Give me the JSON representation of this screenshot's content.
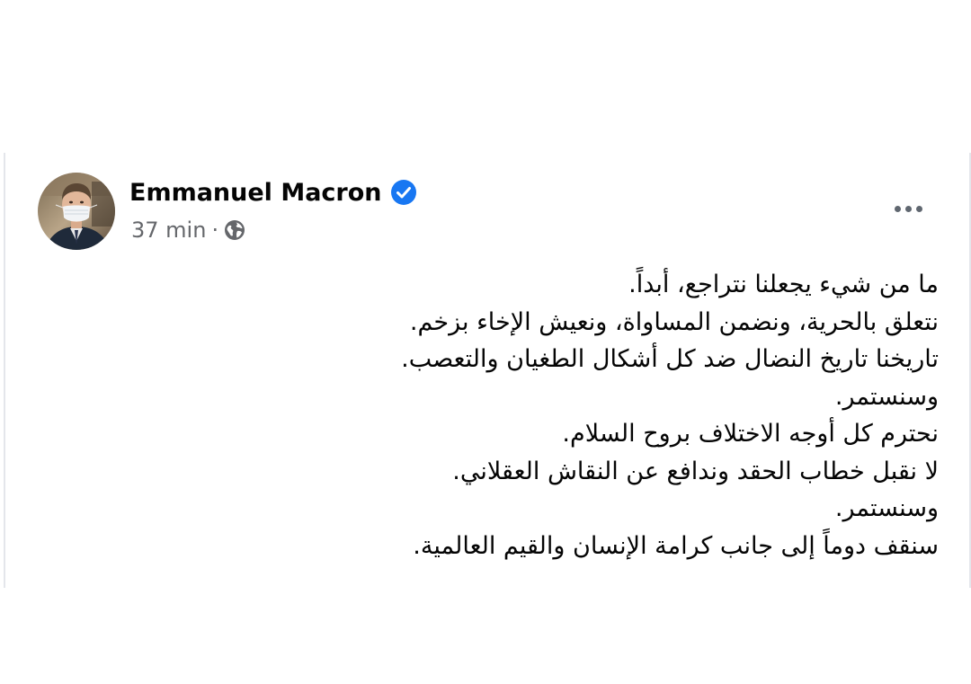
{
  "post": {
    "author": "Emmanuel Macron",
    "verified_icon": "verified-badge-icon",
    "time": "37 min",
    "separator": "·",
    "audience_icon": "globe-icon",
    "more_icon": "more-options-icon",
    "lines": [
      "ما من شيء يجعلنا نتراجع، أبداً.",
      "نتعلق بالحرية، ونضمن المساواة، ونعيش الإخاء بزخم.",
      "تاريخنا تاريخ النضال ضد كل أشكال الطغيان والتعصب.",
      "وسنستمر.",
      "نحترم كل أوجه الاختلاف بروح السلام.",
      "لا نقبل خطاب الحقد وندافع عن النقاش العقلاني.",
      "وسنستمر.",
      "سنقف دوماً إلى جانب كرامة الإنسان والقيم العالمية."
    ]
  },
  "colors": {
    "name": "#050505",
    "meta": "#65676b",
    "verified": "#1877f2",
    "border": "#e4e6eb"
  }
}
